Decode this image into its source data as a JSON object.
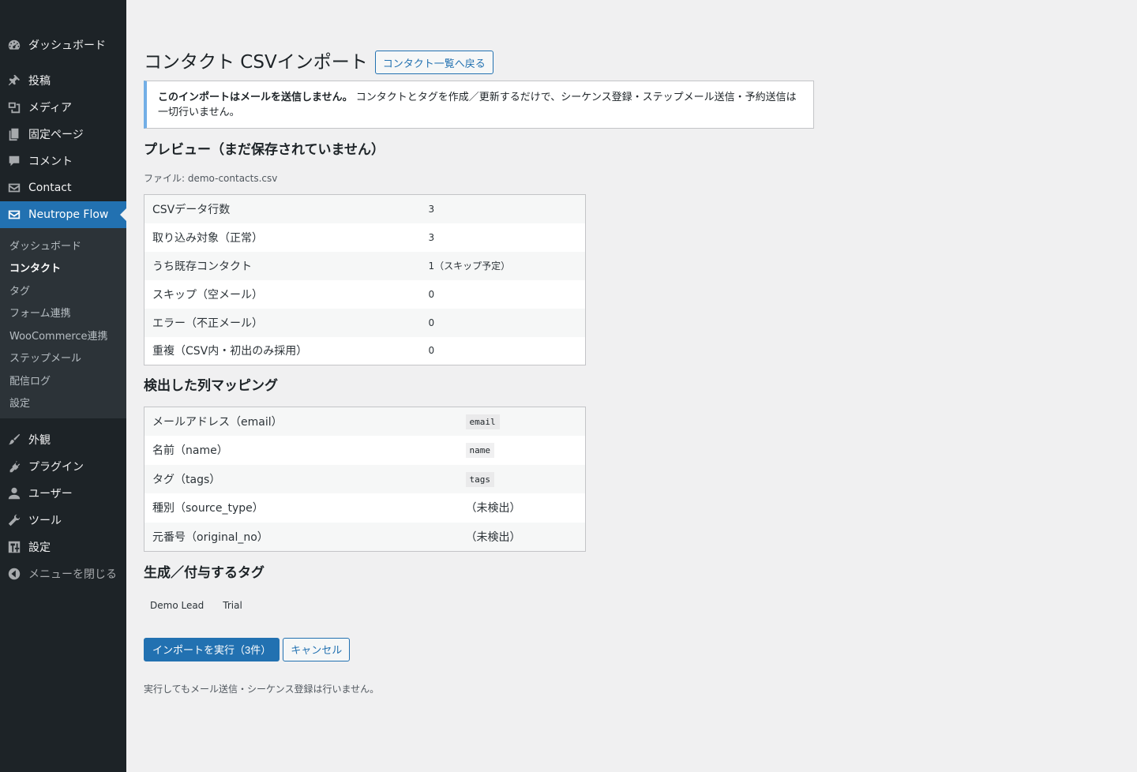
{
  "sidebar": {
    "items": [
      {
        "label": "ダッシュボード",
        "icon": "dashboard-icon"
      },
      {
        "label": "投稿",
        "icon": "pin-icon"
      },
      {
        "label": "メディア",
        "icon": "media-icon"
      },
      {
        "label": "固定ページ",
        "icon": "pages-icon"
      },
      {
        "label": "コメント",
        "icon": "comment-icon"
      },
      {
        "label": "Contact",
        "icon": "mail-icon"
      },
      {
        "label": "Neutrope Flow",
        "icon": "mail-icon"
      },
      {
        "label": "外観",
        "icon": "brush-icon"
      },
      {
        "label": "プラグイン",
        "icon": "plugin-icon"
      },
      {
        "label": "ユーザー",
        "icon": "user-icon"
      },
      {
        "label": "ツール",
        "icon": "wrench-icon"
      },
      {
        "label": "設定",
        "icon": "settings-icon"
      },
      {
        "label": "メニューを閉じる",
        "icon": "collapse-icon"
      }
    ],
    "submenu": [
      "ダッシュボード",
      "コンタクト",
      "タグ",
      "フォーム連携",
      "WooCommerce連携",
      "ステップメール",
      "配信ログ",
      "設定"
    ]
  },
  "header": {
    "title": "コンタクト CSVインポート",
    "back_button": "コンタクト一覧へ戻る"
  },
  "notice": {
    "strong": "このインポートはメールを送信しません。",
    "text": " コンタクトとタグを作成／更新するだけで、シーケンス登録・ステップメール送信・予約送信は一切行いません。"
  },
  "preview": {
    "heading": "プレビュー（まだ保存されていません）",
    "file_line": "ファイル: demo-contacts.csv",
    "rows": [
      {
        "label": "CSVデータ行数",
        "value": "3"
      },
      {
        "label": "取り込み対象（正常）",
        "value": "3"
      },
      {
        "label": "うち既存コンタクト",
        "value": "1（スキップ予定）"
      },
      {
        "label": "スキップ（空メール）",
        "value": "0"
      },
      {
        "label": "エラー（不正メール）",
        "value": "0"
      },
      {
        "label": "重複（CSV内・初出のみ採用）",
        "value": "0"
      }
    ]
  },
  "mapping": {
    "heading": "検出した列マッピング",
    "rows": [
      {
        "label": "メールアドレス（email）",
        "value": "email"
      },
      {
        "label": "名前（name）",
        "value": "name"
      },
      {
        "label": "タグ（tags）",
        "value": "tags"
      },
      {
        "label": "種別（source_type）",
        "value": "（未検出）"
      },
      {
        "label": "元番号（original_no）",
        "value": "（未検出）"
      }
    ]
  },
  "tags": {
    "heading": "生成／付与するタグ",
    "items": [
      "Demo Lead",
      "Trial"
    ]
  },
  "actions": {
    "run_label": "インポートを実行（3件）",
    "cancel_label": "キャンセル"
  },
  "footnote": "実行してもメール送信・シーケンス登録は行いません。"
}
